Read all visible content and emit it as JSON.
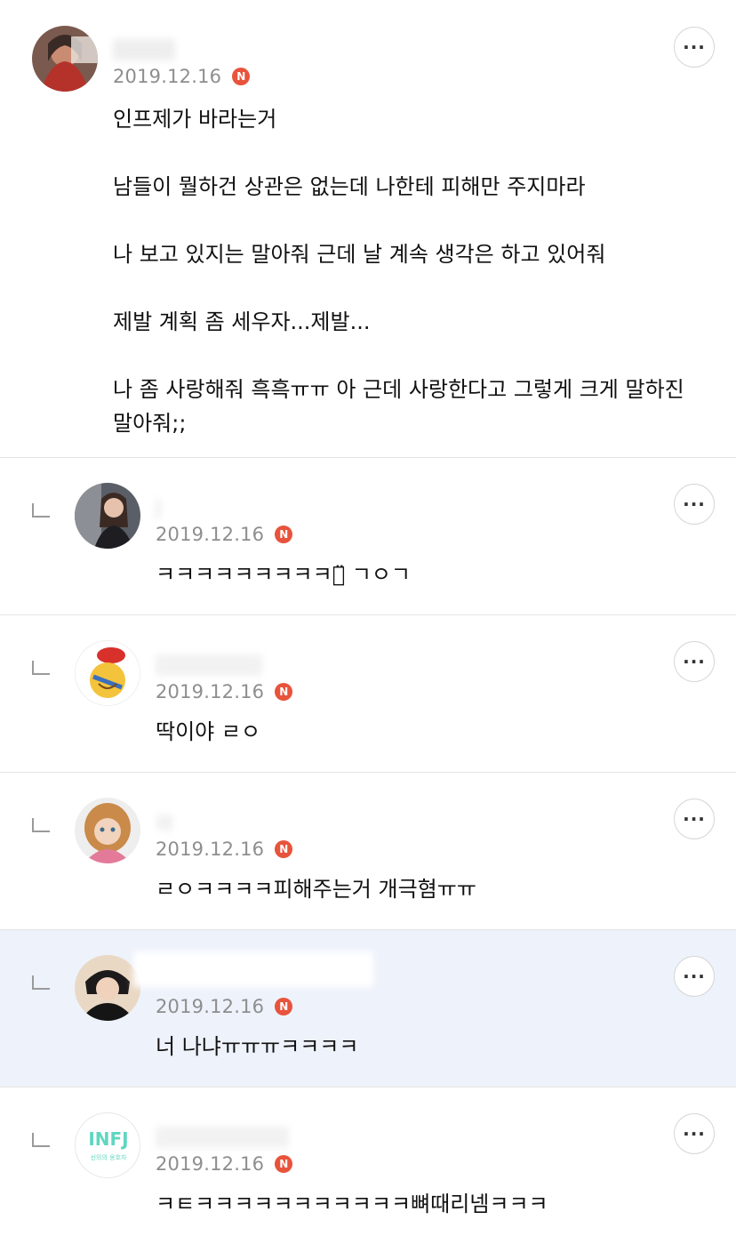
{
  "comments": [
    {
      "nickname": "",
      "date": "2019.12.16",
      "badge": "N",
      "text": "인프제가 바라는거\n\n남들이 뭘하건 상관은 없는데 나한테 피해만 주지마라\n\n나 보고 있지는 말아줘 근데 날 계속 생각은 하고 있어줘\n\n제발 계획 좀 세우자...제발...\n\n나 좀 사랑해줘 흑흑ㅠㅠ 아 근데 사랑한다고 그렇게 크게 말하진 말아줘;;",
      "more": "···"
    }
  ],
  "replies": [
    {
      "nickname": "J",
      "date": "2019.12.16",
      "badge": "N",
      "text": "ㅋㅋㅋㅋㅋㅋㅋㅋㅋㅋ̈ ㄱㅇㄱ",
      "more": "···"
    },
    {
      "nickname": "",
      "date": "2019.12.16",
      "badge": "N",
      "text": "딱이야 ㄹㅇ",
      "more": "···"
    },
    {
      "nickname": "와",
      "date": "2019.12.16",
      "badge": "N",
      "text": "ㄹㅇㅋㅋㅋㅋ피해주는거 개극혐ㅠㅠ",
      "more": "···"
    },
    {
      "nickname": "",
      "date": "2019.12.16",
      "badge": "N",
      "text": "너 나냐ㅠㅠㅠㅋㅋㅋㅋ",
      "more": "···",
      "highlighted": true
    },
    {
      "nickname": "",
      "date": "2019.12.16",
      "badge": "N",
      "text": "ㅋㅌㅋㅋㅋㅋㅋㅋㅋㅋㅋㅋㅋ뼈때리넴ㅋㅋㅋ",
      "more": "···",
      "avatar_text": "INFJ",
      "avatar_subtext": "선의의 옹호자"
    }
  ],
  "colors": {
    "badge": "#e8533c",
    "highlight_bg": "#eef2fb",
    "date": "#8e8e8e",
    "divider": "#e4e4e4",
    "infj_logo": "#5fd6c0"
  },
  "icons": {
    "more": "more-dots-icon",
    "reply": "reply-arrow-icon",
    "badge": "new-badge-icon"
  }
}
